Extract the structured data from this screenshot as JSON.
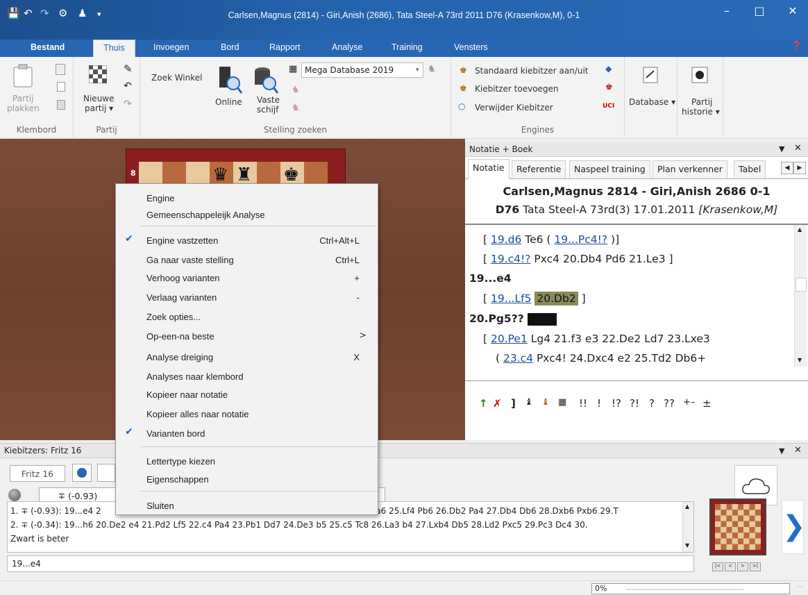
{
  "window": {
    "title": "Carlsen,Magnus (2814) - Giri,Anish (2686), Tata Steel-A 73rd 2011  D76  (Krasenkow,M), 0-1",
    "minimize": "–",
    "maximize": "□",
    "close": "✕"
  },
  "ribbon_tabs": [
    "Bestand",
    "Thuis",
    "Invoegen",
    "Bord",
    "Rapport",
    "Analyse",
    "Training",
    "Vensters"
  ],
  "ribbon": {
    "klembord": {
      "label": "Klembord",
      "paste_line1": "Partij",
      "paste_line2": "plakken"
    },
    "partij": {
      "label": "Partij",
      "new_line1": "Nieuwe",
      "new_line2": "partij ▾"
    },
    "zoek": {
      "label": "Stelling zoeken",
      "shop": "Zoek Winkel",
      "online": "Online",
      "vaste1": "Vaste",
      "vaste2": "schijf",
      "db_select": "Mega Database 2019"
    },
    "engines": {
      "label": "Engines",
      "std": "Standaard kiebitzer aan/uit",
      "add": "Kiebitzer toevoegen",
      "remove": "Verwijder Kiebitzer"
    },
    "database": {
      "label": "Database ▾"
    },
    "historie": {
      "line1": "Partij",
      "line2": "historie ▾"
    }
  },
  "notation": {
    "pane_title": "Notatie + Boek",
    "tabs": [
      "Notatie",
      "Referentie",
      "Naspeel training",
      "Plan verkenner",
      "Tabel"
    ],
    "header_line1": "Carlsen,Magnus 2814 - Giri,Anish 2686  0-1",
    "header_eco": "D76",
    "header_event": " Tata Steel-A 73rd(3) 17.01.2011 ",
    "header_annot": "[Krasenkow,M]",
    "lines": {
      "l1_open": "[ ",
      "l1_m": "19.d6",
      "l1_mid": " Te6 ( ",
      "l1_v": "19...Pc4!?",
      "l1_close": " )]",
      "l2_open": "[ ",
      "l2_m": "19.c4!?",
      "l2_rest": " Pxc4  20.Db4  Pd6  21.Le3 ]",
      "l3": "19...e4",
      "l4_open": "[ ",
      "l4_m": "19...Lf5",
      "l4_hl": "20.Db2",
      "l4_close": " ]",
      "l5": "20.Pg5??",
      "l6_open": "[ ",
      "l6_m": "20.Pe1",
      "l6_rest": "  Lg4  21.f3  e3  22.De2  Ld7  23.Lxe3",
      "l7_open": "( ",
      "l7_m": "23.c4",
      "l7_rest": "  Pxc4!  24.Dxc4  e2  25.Td2  Db6+"
    },
    "symbols": [
      "!!",
      "!",
      "!?",
      "?!",
      "?",
      "??",
      "+–",
      "±"
    ]
  },
  "board": {
    "rank_label": "8"
  },
  "context_menu": {
    "items": [
      {
        "label": "Engine",
        "shortcut": "",
        "checked": false
      },
      {
        "label": "Gemeenschappeleijk Analyse",
        "shortcut": "",
        "checked": false
      },
      {
        "label": "Engine vastzetten",
        "shortcut": "Ctrl+Alt+L",
        "checked": true
      },
      {
        "label": "Ga naar vaste stelling",
        "shortcut": "Ctrl+L",
        "checked": false
      },
      {
        "label": "Verhoog varianten",
        "shortcut": "+",
        "checked": false
      },
      {
        "label": "Verlaag varianten",
        "shortcut": "-",
        "checked": false
      },
      {
        "label": "Zoek opties...",
        "shortcut": "",
        "checked": false
      },
      {
        "label": "Op-een-na beste",
        "shortcut": "",
        "checked": false
      },
      {
        "label": "Analyse dreiging",
        "shortcut": "X",
        "checked": false
      },
      {
        "label": "Analyses naar klembord",
        "shortcut": "",
        "checked": false
      },
      {
        "label": "Kopieer naar notatie",
        "shortcut": "",
        "checked": false
      },
      {
        "label": "Kopieer alles naar notatie",
        "shortcut": "",
        "checked": false
      },
      {
        "label": "Varianten bord",
        "shortcut": "",
        "checked": true
      },
      {
        "label": "Lettertype kiezen",
        "shortcut": "",
        "checked": false
      },
      {
        "label": "Eigenschappen",
        "shortcut": "",
        "checked": false
      },
      {
        "label": "Sluiten",
        "shortcut": "",
        "checked": false
      }
    ],
    "submenu_arrow": ">"
  },
  "kibitzer": {
    "pane_title": "Kiebitzers: Fritz 16",
    "engine_tab": "Fritz 16",
    "eval": "∓ (-0.93)",
    "line1_a": "1. ∓ (-0.93): 19...e4 2",
    "line1_b": "4 Da6 25.Lf4 Pb6 26.Db2 Pa4 27.Db4 Db6 28.Dxb6 Pxb6 29.T",
    "line2": "2. ∓ (-0.34): 19...h6 20.De2 e4 21.Pd2 Lf5 22.c4 Pa4 23.Pb1 Dd7 24.De3 b5 25.c5 Tc8 26.La3 b4 27.Lxb4 Db5 28.Ld2 Pxc5 29.Pc3 Dc4 30.",
    "summary": "Zwart is beter",
    "move": "19...e4"
  },
  "status": {
    "progress_text": "0%",
    "progress_value": 0
  },
  "colors": {
    "accent": "#2766b2",
    "title_bg": "#1c4f8e",
    "highlight": "#8a8a5a"
  }
}
